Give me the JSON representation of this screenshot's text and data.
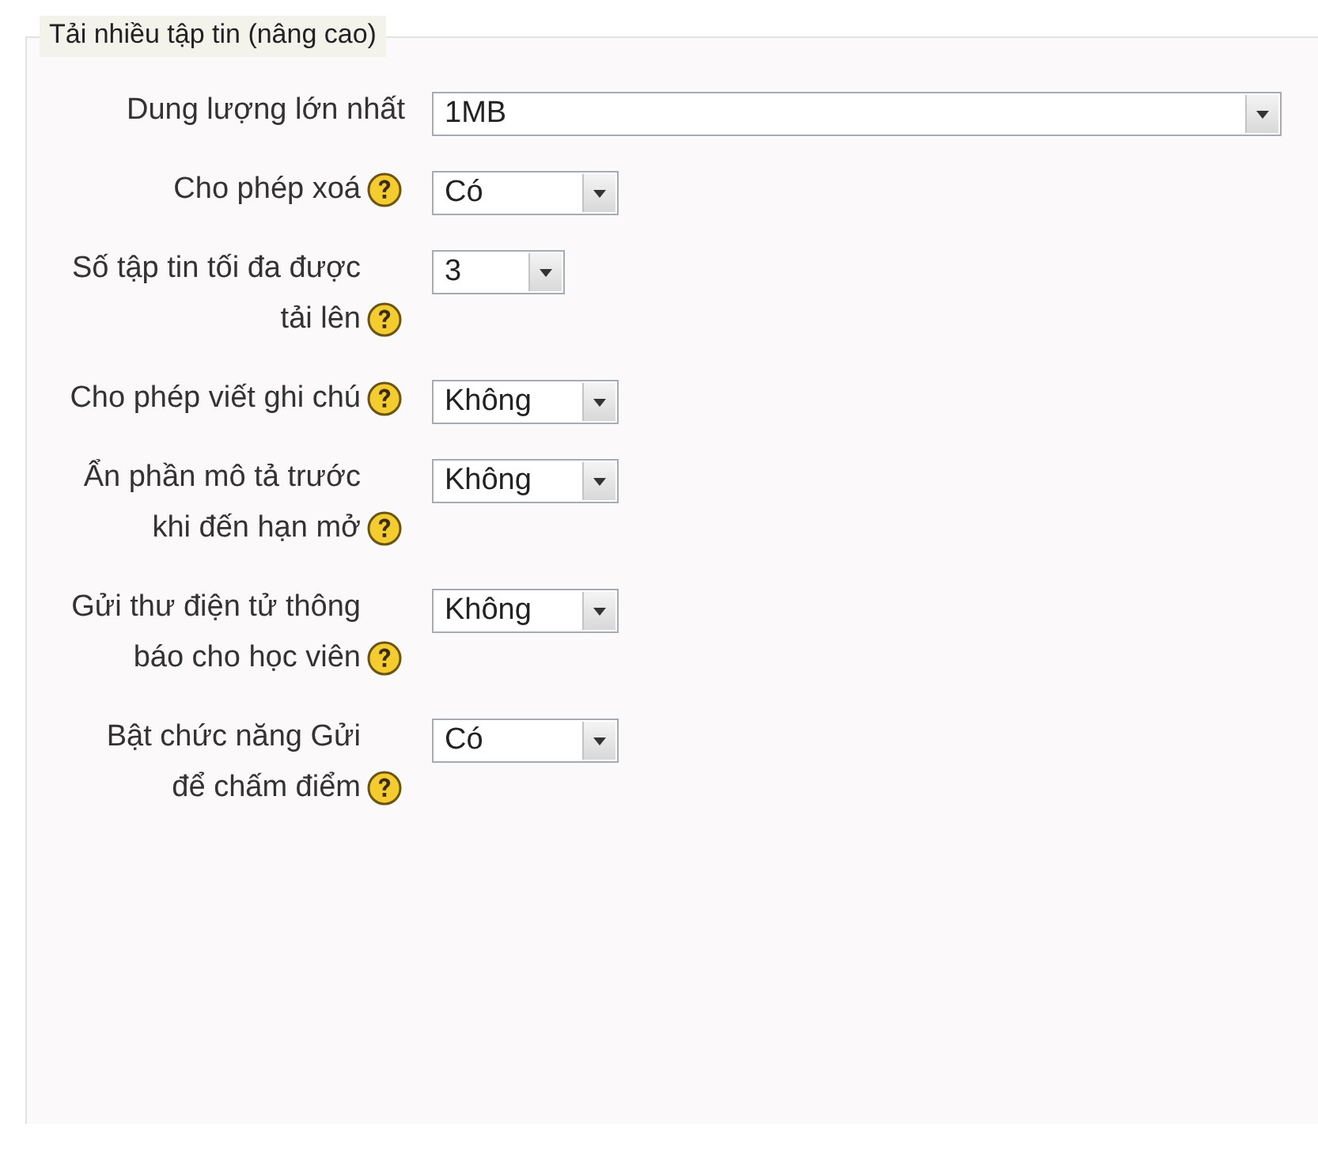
{
  "section": {
    "legend": "Tải nhiều tập tin (nâng cao)"
  },
  "fields": [
    {
      "label": "Dung lượng lớn nhất",
      "help": false,
      "value": "1MB",
      "kind": "wide"
    },
    {
      "label": "Cho phép xoá",
      "help": true,
      "value": "Có",
      "kind": "short"
    },
    {
      "label": "Số tập tin tối đa được tải lên",
      "help": true,
      "value": "3",
      "kind": "tiny"
    },
    {
      "label": "Cho phép viết ghi chú",
      "help": true,
      "value": "Không",
      "kind": "short"
    },
    {
      "label": "Ẩn phần mô tả trước khi đến hạn mở",
      "help": true,
      "value": "Không",
      "kind": "short"
    },
    {
      "label": "Gửi thư điện tử thông báo cho học viên",
      "help": true,
      "value": "Không",
      "kind": "short"
    },
    {
      "label": "Bật chức năng Gửi để chấm điểm",
      "help": true,
      "value": "Có",
      "kind": "short"
    }
  ]
}
